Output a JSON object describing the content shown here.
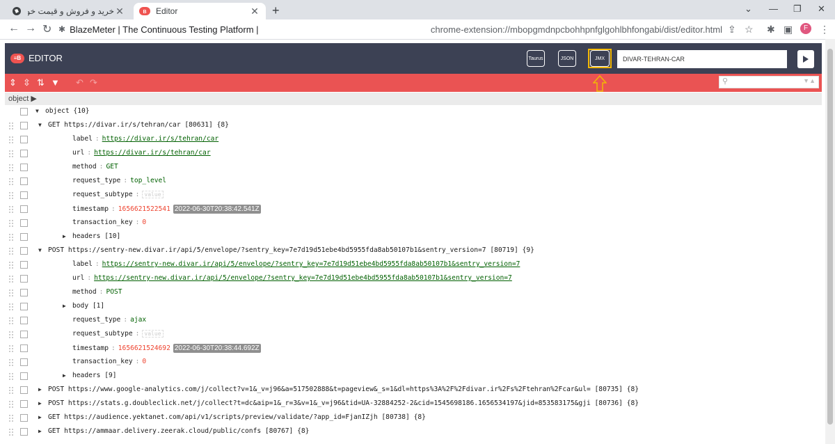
{
  "browser": {
    "tabs": [
      {
        "title": "خرید و فروش و قیمت خودرو در تهرا",
        "active": false
      },
      {
        "title": "Editor",
        "active": true
      }
    ],
    "close_glyph": "✕",
    "new_tab_glyph": "+",
    "site_title": "BlazeMeter | The Continuous Testing Platform |",
    "url": "chrome-extension://mbopgmdnpcbohhpnfglgohlbhfongabi/dist/editor.html",
    "profile_initial": "F"
  },
  "editor": {
    "title": "EDITOR",
    "logo_text": "≡B",
    "format_buttons": [
      "Taurus",
      "JSON",
      "JMX"
    ],
    "test_name": "DIVAR-TEHRAN-CAR",
    "breadcrumb": "object ▶"
  },
  "tree": [
    {
      "indent": 0,
      "tri": "down",
      "text": "object {10}"
    },
    {
      "indent": 1,
      "tri": "down",
      "text": "GET https://divar.ir/s/tehran/car [80631] {8}"
    },
    {
      "indent": 2,
      "key": "label",
      "type": "link",
      "value": "https://divar.ir/s/tehran/car"
    },
    {
      "indent": 2,
      "key": "url",
      "type": "link",
      "value": "https://divar.ir/s/tehran/car"
    },
    {
      "indent": 2,
      "key": "method",
      "type": "str",
      "value": "GET"
    },
    {
      "indent": 2,
      "key": "request_type",
      "type": "str",
      "value": "top_level"
    },
    {
      "indent": 2,
      "key": "request_subtype",
      "type": "placeholder",
      "value": "value"
    },
    {
      "indent": 2,
      "key": "timestamp",
      "type": "num",
      "value": "1656621522541",
      "tag": "2022-06-30T20:38:42.541Z"
    },
    {
      "indent": 2,
      "key": "transaction_key",
      "type": "num",
      "value": "0"
    },
    {
      "indent": 2,
      "tri": "right",
      "text": "headers [10]"
    },
    {
      "indent": 1,
      "tri": "down",
      "text": "POST https://sentry-new.divar.ir/api/5/envelope/?sentry_key=7e7d19d51ebe4bd5955fda8ab50107b1&sentry_version=7 [80719] {9}"
    },
    {
      "indent": 2,
      "key": "label",
      "type": "link",
      "value": "https://sentry-new.divar.ir/api/5/envelope/?sentry_key=7e7d19d51ebe4bd5955fda8ab50107b1&sentry_version=7"
    },
    {
      "indent": 2,
      "key": "url",
      "type": "link",
      "value": "https://sentry-new.divar.ir/api/5/envelope/?sentry_key=7e7d19d51ebe4bd5955fda8ab50107b1&sentry_version=7"
    },
    {
      "indent": 2,
      "key": "method",
      "type": "str",
      "value": "POST"
    },
    {
      "indent": 2,
      "tri": "right",
      "text": "body [1]"
    },
    {
      "indent": 2,
      "key": "request_type",
      "type": "str",
      "value": "ajax"
    },
    {
      "indent": 2,
      "key": "request_subtype",
      "type": "placeholder",
      "value": "value"
    },
    {
      "indent": 2,
      "key": "timestamp",
      "type": "num",
      "value": "1656621524692",
      "tag": "2022-06-30T20:38:44.692Z"
    },
    {
      "indent": 2,
      "key": "transaction_key",
      "type": "num",
      "value": "0"
    },
    {
      "indent": 2,
      "tri": "right",
      "text": "headers [9]"
    },
    {
      "indent": 1,
      "tri": "right",
      "text": "POST https://www.google-analytics.com/j/collect?v=1&_v=j96&a=517502888&t=pageview&_s=1&dl=https%3A%2F%2Fdivar.ir%2Fs%2Ftehran%2Fcar&ul= [80735] {8}"
    },
    {
      "indent": 1,
      "tri": "right",
      "text": "POST https://stats.g.doubleclick.net/j/collect?t=dc&aip=1&_r=3&v=1&_v=j96&tid=UA-32884252-2&cid=1545698186.1656534197&jid=853583175&gji [80736] {8}"
    },
    {
      "indent": 1,
      "tri": "right",
      "text": "GET https://audience.yektanet.com/api/v1/scripts/preview/validate/?app_id=FjanIZjh [80738] {8}"
    },
    {
      "indent": 1,
      "tri": "right",
      "text": "GET https://ammaar.delivery.zeerak.cloud/public/confs [80767] {8}"
    }
  ],
  "colors": {
    "header_bg": "#3c4154",
    "toolbar_red": "#ea5353",
    "highlight": "#f2b705",
    "link_green": "#006000",
    "number_red": "#ee422e"
  }
}
